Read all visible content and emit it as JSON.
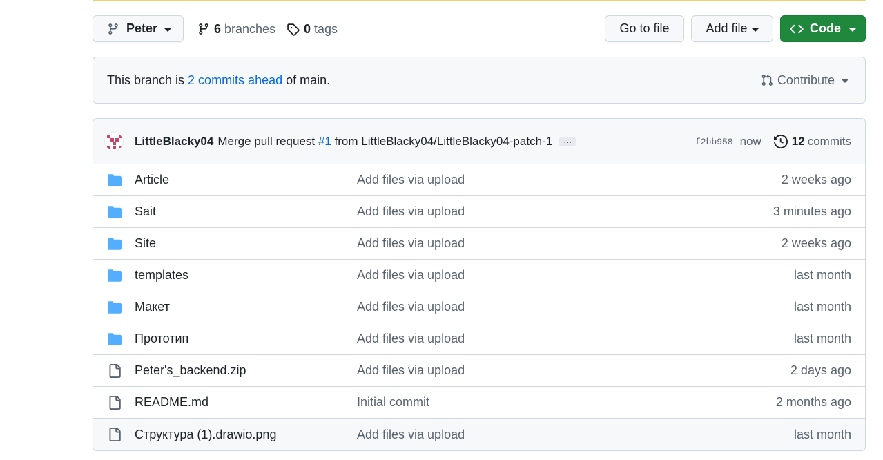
{
  "toolbar": {
    "branch": "Peter",
    "branches_count": "6",
    "branches_label": "branches",
    "tags_count": "0",
    "tags_label": "tags",
    "go_to_file": "Go to file",
    "add_file": "Add file",
    "code": "Code"
  },
  "ahead": {
    "prefix": "This branch is",
    "link": "2 commits ahead",
    "suffix": "of main.",
    "contribute": "Contribute"
  },
  "commit": {
    "author": "LittleBlacky04",
    "message_start": "Merge pull request",
    "pr": "#1",
    "message_end": "from LittleBlacky04/LittleBlacky04-patch-1",
    "ellipsis": "…",
    "sha": "f2bb958",
    "time": "now",
    "count": "12",
    "count_label": "commits"
  },
  "files": [
    {
      "type": "folder",
      "name": "Article",
      "message": "Add files via upload",
      "age": "2 weeks ago"
    },
    {
      "type": "folder",
      "name": "Sait",
      "message": "Add files via upload",
      "age": "3 minutes ago"
    },
    {
      "type": "folder",
      "name": "Site",
      "message": "Add files via upload",
      "age": "2 weeks ago"
    },
    {
      "type": "folder",
      "name": "templates",
      "message": "Add files via upload",
      "age": "last month"
    },
    {
      "type": "folder",
      "name": "Макет",
      "message": "Add files via upload",
      "age": "last month"
    },
    {
      "type": "folder",
      "name": "Прототип",
      "message": "Add files via upload",
      "age": "last month"
    },
    {
      "type": "file",
      "name": "Peter's_backend.zip",
      "message": "Add files via upload",
      "age": "2 days ago"
    },
    {
      "type": "file",
      "name": "README.md",
      "message": "Initial commit",
      "age": "2 months ago"
    },
    {
      "type": "file",
      "name": "Структура (1).drawio.png",
      "message": "Add files via upload",
      "age": "last month"
    }
  ],
  "colors": {
    "accent": "#0969da",
    "code_button": "#1f883d",
    "folder": "#54aeff",
    "file": "#59636e"
  }
}
